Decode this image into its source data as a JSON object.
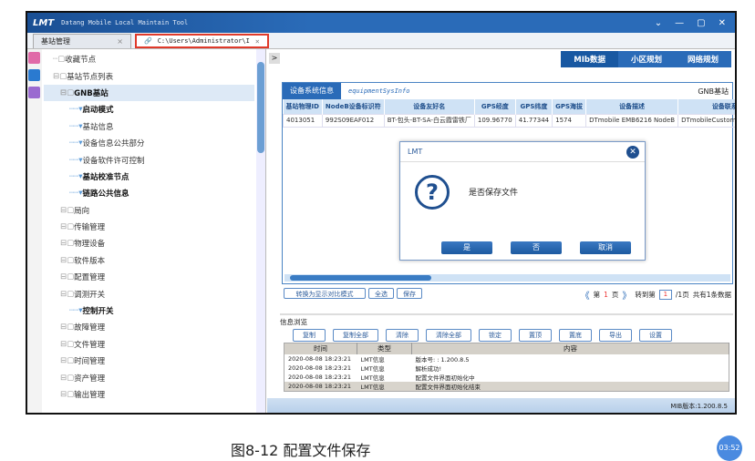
{
  "window": {
    "logo": "LMT",
    "title": "Datang Mobile Local Maintain Tool",
    "controls": [
      "⌄",
      "—",
      "▢",
      "✕"
    ]
  },
  "tabs": [
    {
      "label": "基站管理"
    },
    {
      "label": "C:\\Users\\Administrator\\I"
    }
  ],
  "tree": [
    "收藏节点",
    "基站节点列表",
    "GNB基站",
    "启动模式",
    "基站信息",
    "设备信息公共部分",
    "设备软件许可控制",
    "基站校准节点",
    "链路公共信息",
    "局向",
    "传输管理",
    "物理设备",
    "软件版本",
    "配置管理",
    "调测开关",
    "控制开关",
    "故障管理",
    "文件管理",
    "时间管理",
    "资产管理",
    "输出管理"
  ],
  "right_tabs": [
    "MIb数据",
    "小区规划",
    "网络规划"
  ],
  "panel": {
    "title": "设备系统信息",
    "subtitle": "equipmentSysInfo",
    "node": "GNB基站",
    "columns": [
      "基站物理ID",
      "NodeB设备标识符",
      "设备友好名",
      "GPS经度",
      "GPS纬度",
      "GPS海拔",
      "设备描述",
      "设备联系人"
    ],
    "row": [
      "4013051",
      "992S09EAF012",
      "BT-包头-BT-SA-白云霞雷铁厂",
      "109.96770",
      "41.77344",
      "1574",
      "DTmobile EMB6216 NodeB",
      "DTmobileCustomerServiceCe"
    ]
  },
  "actions": [
    "转换为显示对比模式",
    "全选",
    "保存"
  ],
  "pager": {
    "prev": "《",
    "page_label": "第",
    "page": "1",
    "page_unit": "页",
    "next": "》",
    "goto": "转到第",
    "goto_value": "1",
    "total_pages": "/1页",
    "total": "共有1条数据"
  },
  "info": {
    "title": "信息浏览",
    "buttons": [
      "复制",
      "复制全部",
      "清除",
      "清除全部",
      "锁定",
      "置顶",
      "置底",
      "导出",
      "设置"
    ],
    "columns": [
      "时间",
      "类型",
      "内容"
    ],
    "rows": [
      [
        "2020-08-08 18:23:21",
        "LMT信息",
        "版本号: : 1.200.8.5"
      ],
      [
        "2020-08-08 18:23:21",
        "LMT信息",
        "解析成功!"
      ],
      [
        "2020-08-08 18:23:21",
        "LMT信息",
        "配置文件界面初始化中"
      ],
      [
        "2020-08-08 18:23:21",
        "LMT信息",
        "配置文件界面初始化结束"
      ]
    ]
  },
  "status": "MIB版本:1.200.8.5",
  "dialog": {
    "title": "LMT",
    "icon": "question-icon",
    "message": "是否保存文件",
    "buttons": [
      "是",
      "否",
      "取消"
    ]
  },
  "caption": "图8-12  配置文件保存",
  "clock": "03:52"
}
